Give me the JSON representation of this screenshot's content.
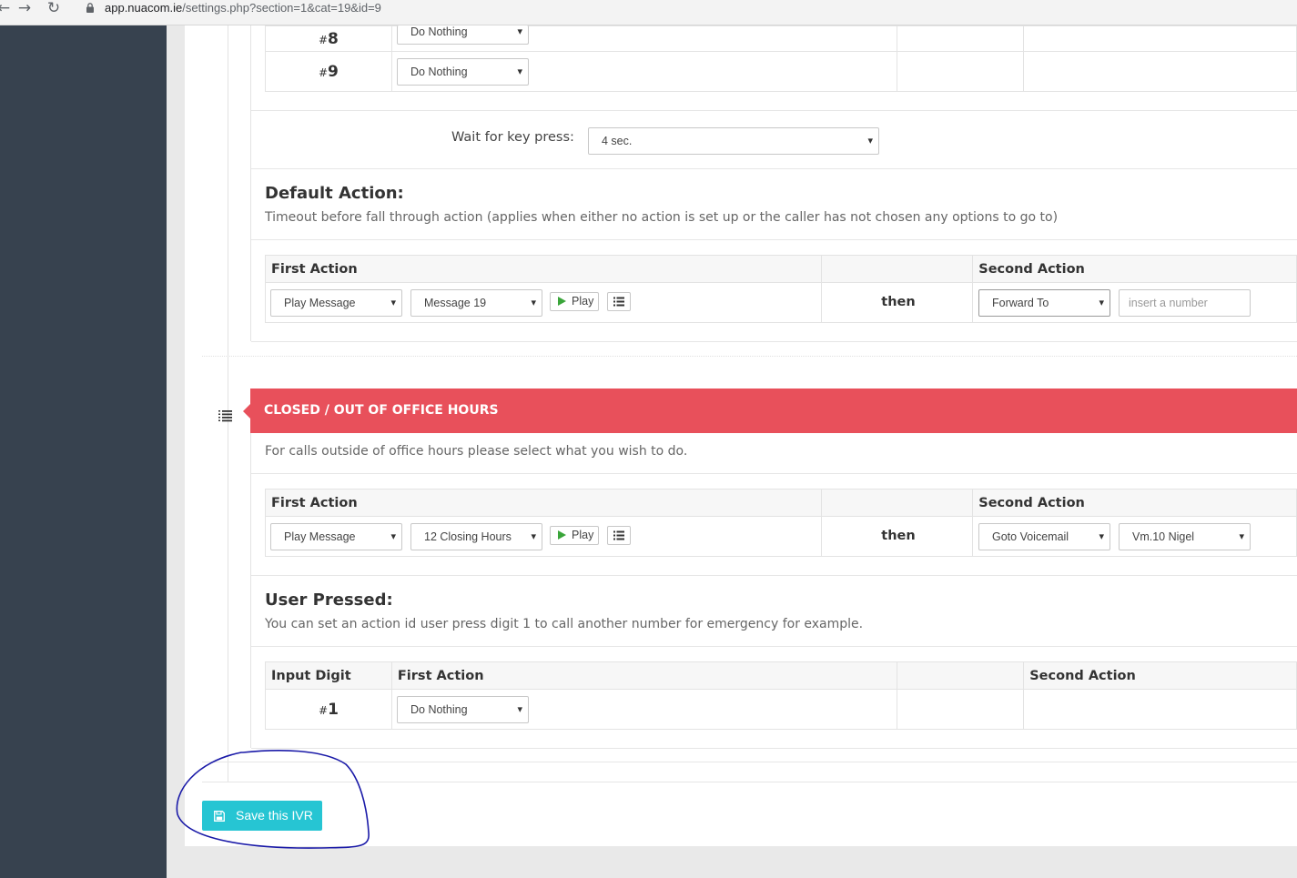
{
  "browser": {
    "url_host": "app.nuacom.ie",
    "url_path": "/settings.php?section=1&cat=19&id=9"
  },
  "top_rows": [
    {
      "hash": "#",
      "digit": "8",
      "first_action": "Do Nothing"
    },
    {
      "hash": "#",
      "digit": "9",
      "first_action": "Do Nothing"
    }
  ],
  "wait": {
    "label": "Wait for key press:",
    "value": "4 sec."
  },
  "default_action": {
    "title": "Default Action:",
    "description": "Timeout before fall through action (applies when either no action is set up or the caller has not chosen any options to go to)",
    "first_action_header": "First Action",
    "second_action_header": "Second Action",
    "first_select": "Play Message",
    "message_select": "Message 19",
    "play_label": "Play",
    "then_label": "then",
    "second_select": "Forward To",
    "number_placeholder": "insert a number"
  },
  "closed": {
    "banner_title": "CLOSED / OUT OF OFFICE HOURS",
    "description": "For calls outside of office hours please select what you wish to do.",
    "first_action_header": "First Action",
    "second_action_header": "Second Action",
    "first_select": "Play Message",
    "message_select": "12 Closing Hours",
    "play_label": "Play",
    "then_label": "then",
    "second_select": "Goto Voicemail",
    "voicemail_select": "Vm.10 Nigel"
  },
  "user_pressed": {
    "title": "User Pressed:",
    "description": "You can set an action id user press digit 1 to call another number for emergency for example.",
    "headers": {
      "input_digit": "Input Digit",
      "first_action": "First Action",
      "second_action": "Second Action"
    },
    "rows": [
      {
        "hash": "#",
        "digit": "1",
        "first_action": "Do Nothing"
      }
    ]
  },
  "save_button": {
    "label": "Save this IVR"
  },
  "colors": {
    "sidebar": "#37424f",
    "banner": "#e8505b",
    "save_button": "#26c5d3",
    "annotation": "#1a1aa8"
  }
}
